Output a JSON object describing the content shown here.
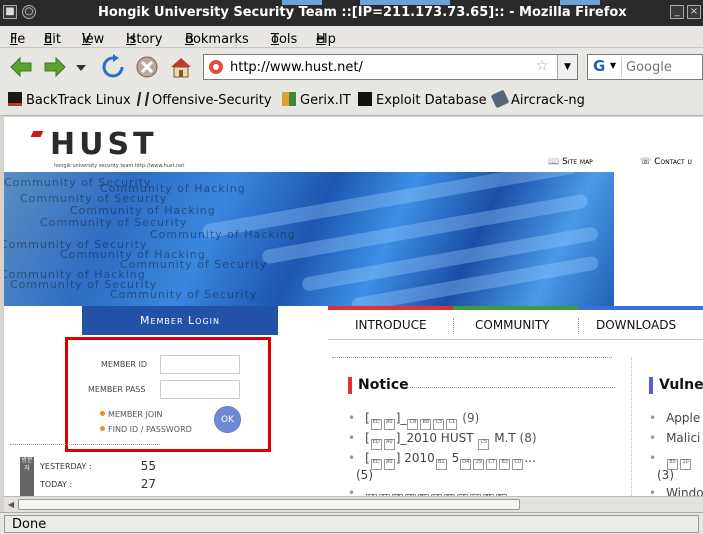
{
  "window": {
    "title": "Hongik University Security Team ::[IP=211.173.73.65]:: - Mozilla Firefox"
  },
  "menu": [
    {
      "label": "File",
      "u": "F",
      "rest": "ile"
    },
    {
      "label": "Edit",
      "u": "E",
      "rest": "dit"
    },
    {
      "label": "View",
      "u": "V",
      "rest": "iew"
    },
    {
      "label": "History",
      "u": "H",
      "rest": "istory"
    },
    {
      "label": "Bookmarks",
      "u": "B",
      "rest": "ookmarks"
    },
    {
      "label": "Tools",
      "u": "T",
      "rest": "ools"
    },
    {
      "label": "Help",
      "u": "H",
      "rest": "elp"
    }
  ],
  "address": {
    "url": "http://www.hust.net/"
  },
  "search": {
    "placeholder": "Google"
  },
  "bookmarks": [
    {
      "label": "BackTrack Linux",
      "icon": "backtrack-icon",
      "color": "#c0392b"
    },
    {
      "label": "Offensive-Security",
      "icon": "offsec-icon",
      "color": "#222222"
    },
    {
      "label": "Gerix.IT",
      "icon": "gerix-icon",
      "color": "#e0a030"
    },
    {
      "label": "Exploit Database",
      "icon": "exploitdb-icon",
      "color": "#111111"
    },
    {
      "label": "Aircrack-ng",
      "icon": "aircrack-icon",
      "color": "#556677"
    }
  ],
  "site": {
    "logo_text": "HUST",
    "logo_sub": "hongik university security team   http://www.hust.net",
    "site_map": "Site map",
    "contact": "Contact u",
    "banner_words": [
      "Community of Security",
      "Community of Hacking",
      "Community of Security",
      "Community of Hacking",
      "Community of Security",
      "Community of Hacking",
      "Community of Security",
      "Community of Hacking",
      "Community of Security",
      "Community of Hacking",
      "Community of Security",
      "Community of Hacking",
      "Community of Security",
      "Community of Hacking",
      "Community of Security"
    ]
  },
  "login": {
    "tab_label": "Member Login",
    "id_label": "MEMBER ID",
    "pass_label": "MEMBER PASS",
    "join_link": "MEMBER JOIN",
    "find_link": "FIND ID / PASSWORD",
    "ok_label": "OK"
  },
  "stats": {
    "side_label": "방문자",
    "yesterday_label": "YESTERDAY :",
    "yesterday": "55",
    "today_label": "TODAY :",
    "today": "27"
  },
  "nav_tabs": [
    "INTRODUCE",
    "COMMUNITY",
    "DOWNLOADS"
  ],
  "notice": {
    "title": "Notice",
    "items": [
      {
        "prefix": "[",
        "glyphs": 2,
        "mid": "]_",
        "glyphs2": 4,
        "suffix": "",
        "count": "(9)"
      },
      {
        "prefix": "[",
        "glyphs": 2,
        "mid": "]_2010 HUST ",
        "glyphs2": 1,
        "suffix": " M.T",
        "count": "(8)"
      },
      {
        "prefix": "[",
        "glyphs": 2,
        "mid": "] 2010",
        "glyphs2": 1,
        "suffix": " 5",
        "count": "..."
      }
    ],
    "wrap_count": "(5)"
  },
  "vuln": {
    "title": "Vulner",
    "items": [
      "Apple",
      "Malici",
      "(3)",
      "Windo"
    ]
  },
  "status": {
    "text": "Done"
  }
}
